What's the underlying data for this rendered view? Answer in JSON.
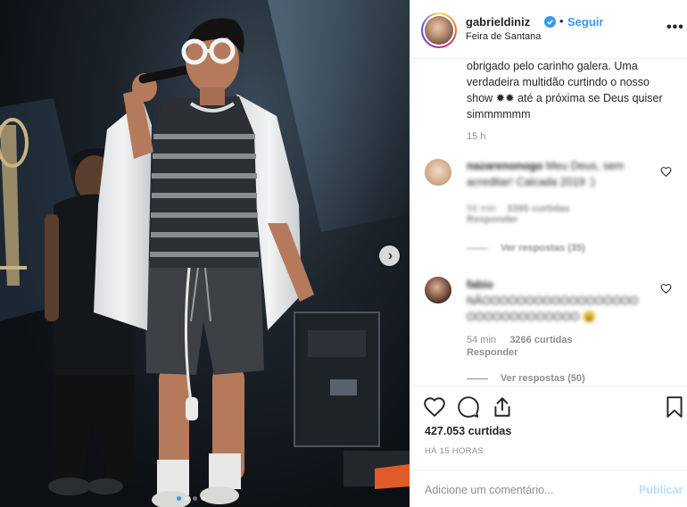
{
  "post": {
    "username": "gabrieldiniz",
    "separator": "•",
    "follow_label": "Seguir",
    "location": "Feira de Santana",
    "more_label": "•••"
  },
  "caption": {
    "text": "obrigado pelo carinho galera. Uma verdadeira multidão curtindo o nosso show ✹✹ até a próxima se Deus quiser simmmmmm",
    "time": "15 h"
  },
  "comments": [
    {
      "user": "nazarenonogo",
      "text": "Meu Deus, sem acreditar! Calcada 2019 :)",
      "time": "56 min",
      "likes": "3395 curtidas",
      "reply_label": "Responder",
      "view_replies": "Ver respostas (35)"
    },
    {
      "user": "fabio",
      "text": "NÂOOOOOOOOOOOOOOOOOO OOOOOOOOOOOOO 😩",
      "time": "54 min",
      "likes": "3266 curtidas",
      "reply_label": "Responder",
      "view_replies": "Ver respostas (50)"
    }
  ],
  "stats": {
    "likes": "427.053 curtidas",
    "time_ago": "HÁ 15 HORAS"
  },
  "add_comment": {
    "placeholder": "Adicione um comentário...",
    "publish_label": "Publicar"
  },
  "carousel": {
    "next_glyph": "›",
    "current_index": 1,
    "count": 4
  },
  "colors": {
    "link_blue": "#3897f0",
    "text": "#262626",
    "muted": "#8e8e8e",
    "border": "#efefef",
    "publish_disabled": "#b2dffc"
  },
  "icons": [
    "verified-badge-icon",
    "more-options-icon",
    "heart-icon",
    "comment-icon",
    "share-icon",
    "bookmark-icon",
    "next-arrow-icon"
  ]
}
